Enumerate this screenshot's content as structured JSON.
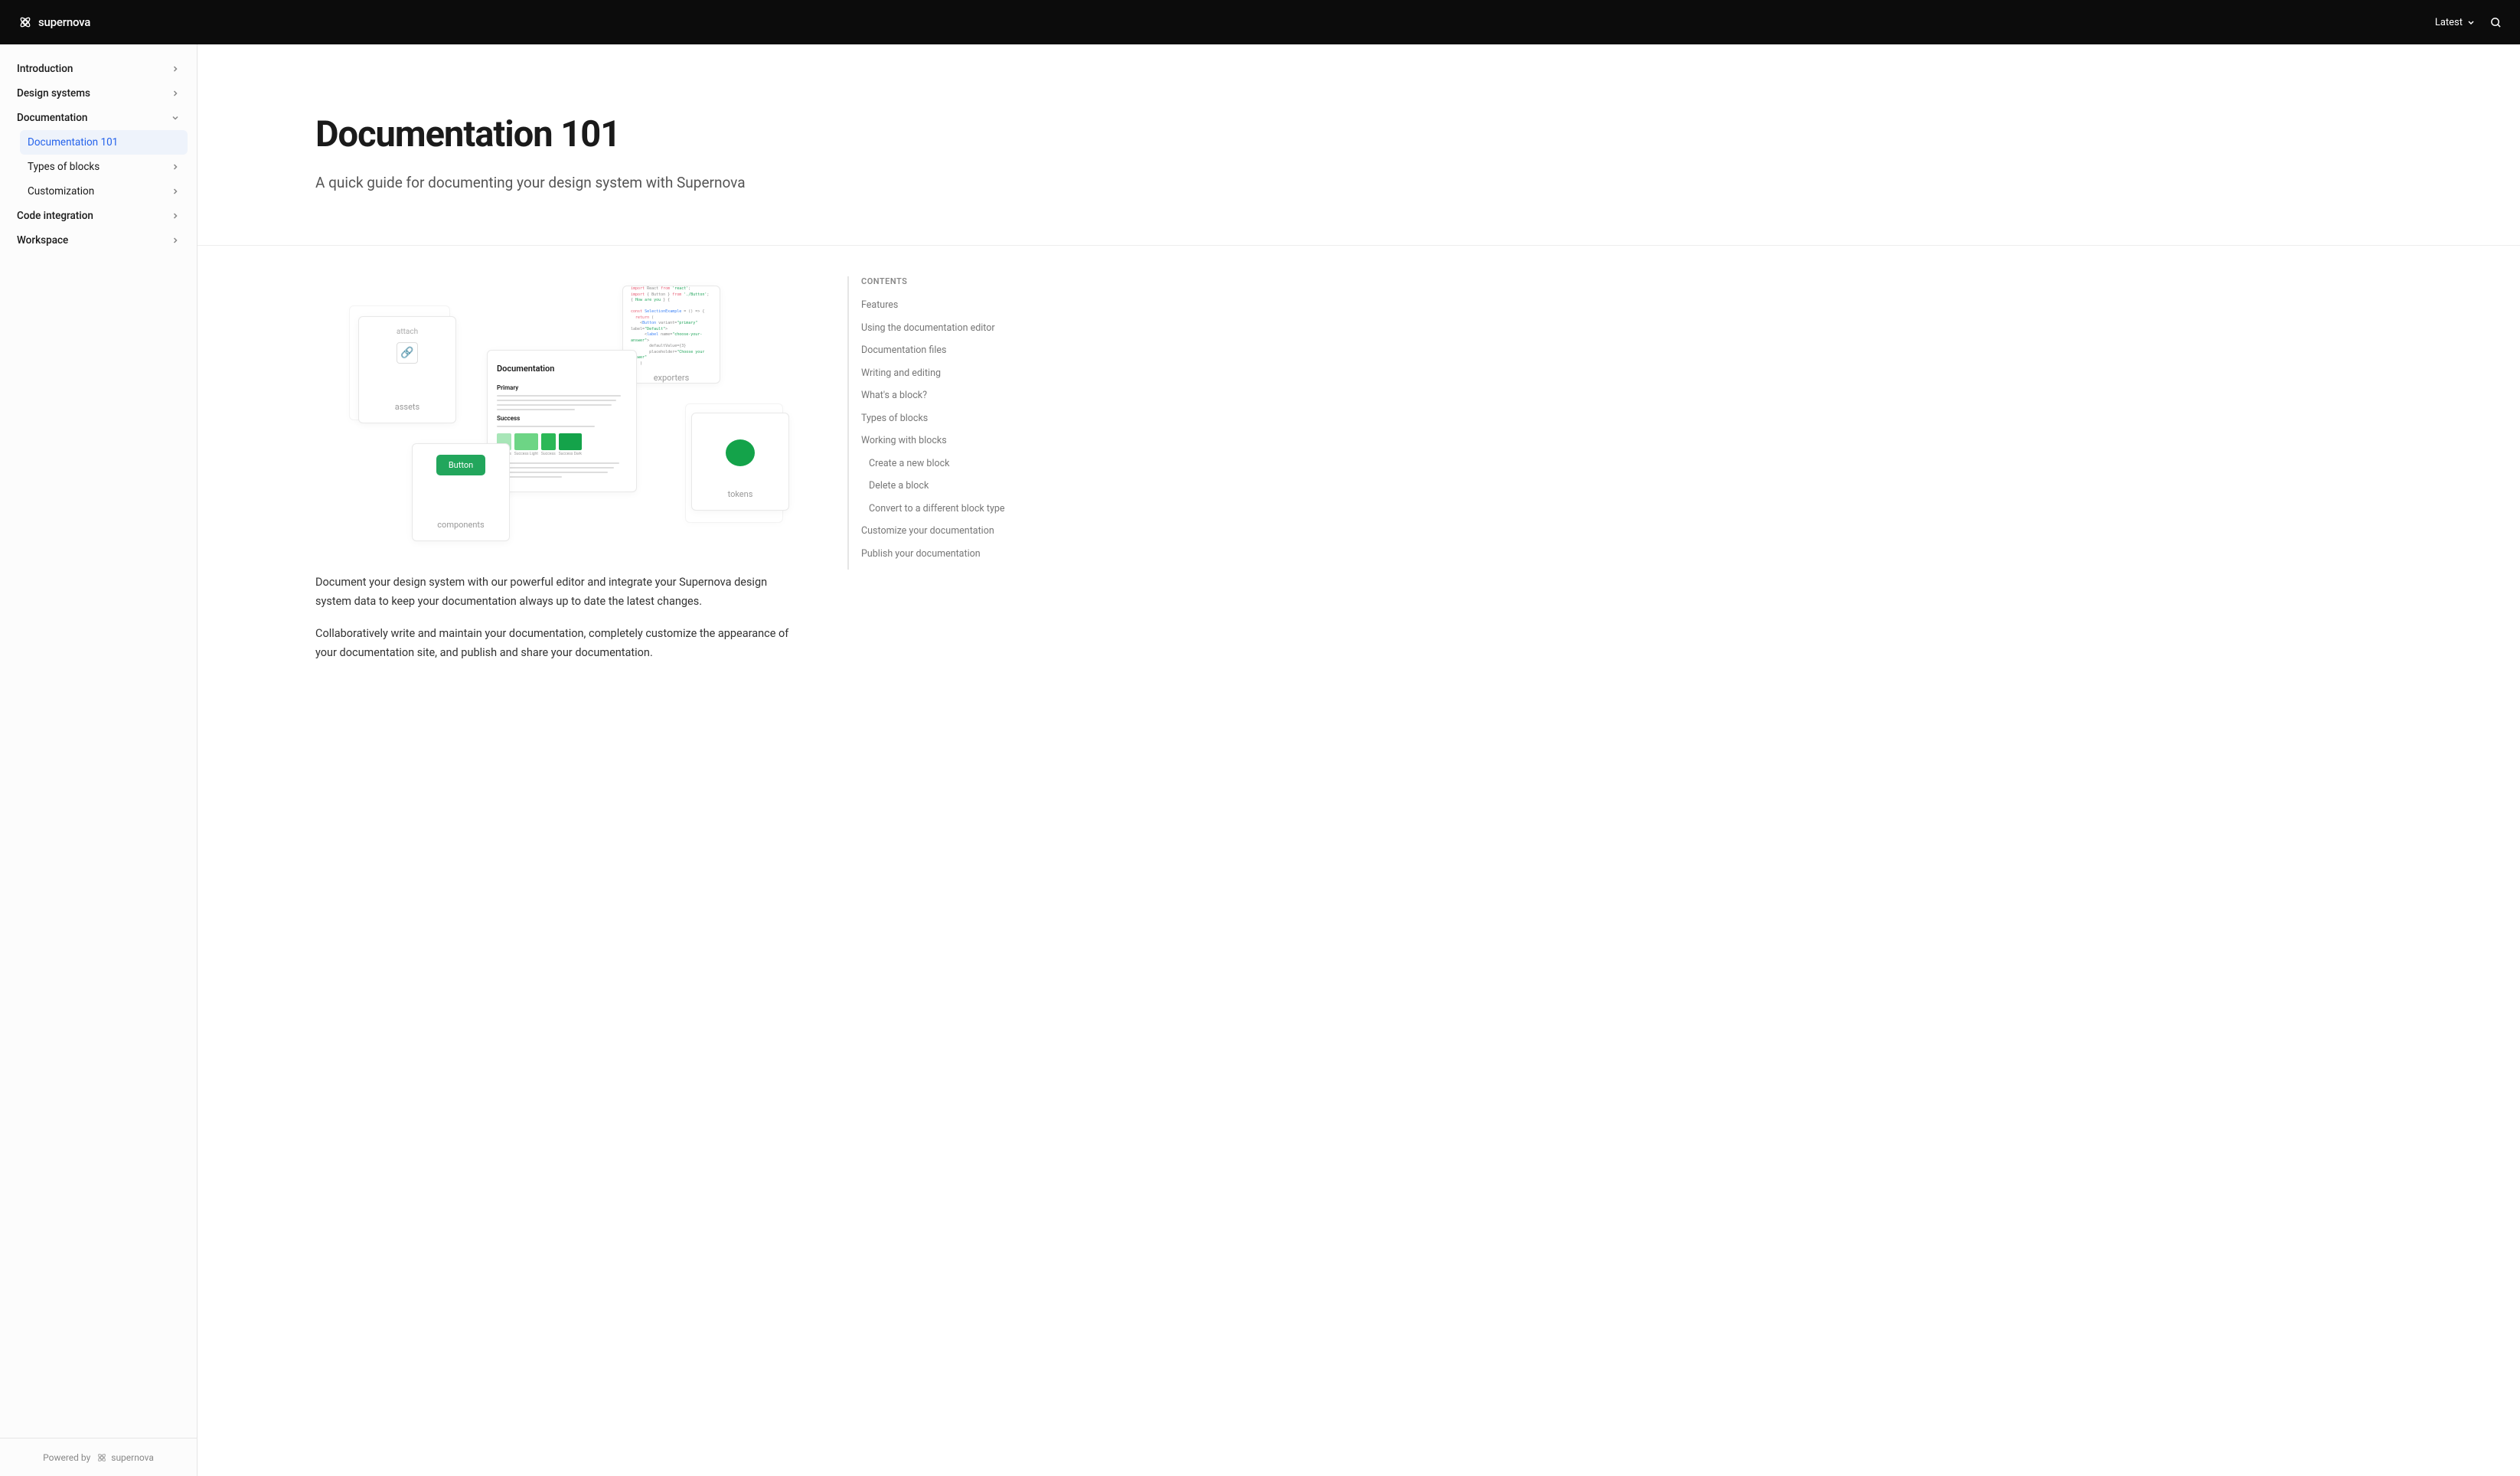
{
  "header": {
    "brand": "supernova",
    "version": "Latest"
  },
  "sidebar": {
    "items": [
      {
        "label": "Introduction",
        "expandable": true
      },
      {
        "label": "Design systems",
        "expandable": true
      },
      {
        "label": "Documentation",
        "expandable": true,
        "expanded": true
      },
      {
        "label": "Code integration",
        "expandable": true
      },
      {
        "label": "Workspace",
        "expandable": true
      }
    ],
    "doc_children": [
      {
        "label": "Documentation 101",
        "active": true
      },
      {
        "label": "Types of blocks",
        "expandable": true
      },
      {
        "label": "Customization",
        "expandable": true
      }
    ]
  },
  "footer": {
    "powered": "Powered by",
    "brand": "supernova"
  },
  "hero": {
    "title": "Documentation 101",
    "subtitle": "A quick guide for documenting your design system with Supernova"
  },
  "illustration": {
    "assets": {
      "title": "attach",
      "label": "assets"
    },
    "components": {
      "button": "Button",
      "label": "components"
    },
    "exporters": {
      "label": "exporters"
    },
    "tokens": {
      "label": "tokens"
    },
    "doc": {
      "title": "Documentation",
      "section1": "Primary",
      "section2": "Success",
      "swatches": [
        "Success",
        "Success Light",
        "Success",
        "Success Dark"
      ],
      "colors": [
        "#a8e6b8",
        "#6dd585",
        "#2bb857",
        "#14a34a"
      ]
    }
  },
  "body": {
    "p1": "Document your design system with our powerful editor and integrate your Supernova design system data to keep your documentation always up to date the latest changes.",
    "p2": "Collaboratively write and maintain your documentation, completely customize the appearance of your documentation site, and publish and share your documentation."
  },
  "toc": {
    "title": "CONTENTS",
    "items": [
      "Features",
      "Using the documentation editor",
      "Documentation files",
      "Writing and editing",
      "What's a block?",
      "Types of blocks",
      "Working with blocks"
    ],
    "sub_items": [
      "Create a new block",
      "Delete a block",
      "Convert to a different block type"
    ],
    "items_after": [
      "Customize your documentation",
      "Publish your documentation"
    ]
  }
}
